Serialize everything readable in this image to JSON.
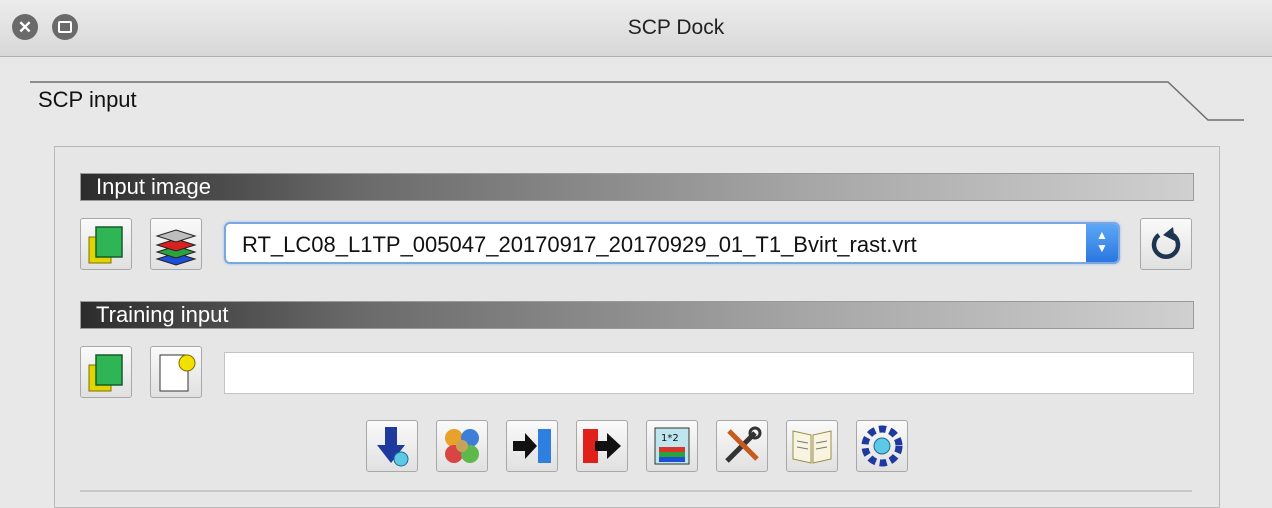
{
  "window": {
    "title": "SCP Dock"
  },
  "tab": {
    "label": "SCP input"
  },
  "input_section": {
    "label": "Input image",
    "selected_image": "RT_LC08_L1TP_005047_20170917_20170929_01_T1_Bvirt_rast.vrt"
  },
  "training_section": {
    "label": "Training input",
    "value": ""
  },
  "toolbar": {
    "items": [
      "download-icon",
      "preprocessing-icon",
      "band-processing-icon",
      "postprocessing-icon",
      "band-calc-icon",
      "settings-icon",
      "user-manual-icon",
      "help-icon"
    ]
  },
  "colors": {
    "accent": "#2a77e0",
    "section_dark": "#2c2c2c"
  }
}
